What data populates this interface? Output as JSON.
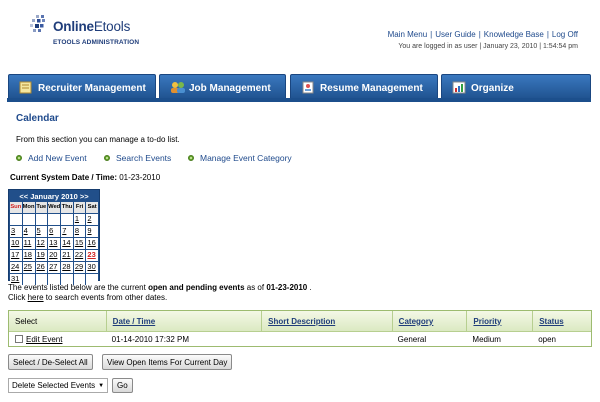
{
  "header": {
    "logo_title_bold": "Online",
    "logo_title_rest": "Etools",
    "logo_subtitle": "ETOOLS ADMINISTRATION",
    "links": [
      "Main Menu",
      "User Guide",
      "Knowledge Base",
      "Log Off"
    ],
    "logged_in_text": "You are logged in as user | January 23, 2010 | 1:54:54 pm"
  },
  "tabs": [
    {
      "label": "Recruiter Management",
      "icon": "notepad-icon"
    },
    {
      "label": "Job Management",
      "icon": "people-icon"
    },
    {
      "label": "Resume Management",
      "icon": "resume-icon"
    },
    {
      "label": "Organize",
      "icon": "chart-icon"
    }
  ],
  "page": {
    "title": "Calendar",
    "intro": "From this section you can manage a to-do list.",
    "actions": [
      "Add New Event",
      "Search Events",
      "Manage Event Category"
    ],
    "current_date_label": "Current System Date / Time:",
    "current_date_value": "01-23-2010"
  },
  "calendar": {
    "header": "<< January 2010 >>",
    "days": [
      "Sun",
      "Mon",
      "Tue",
      "Wed",
      "Thu",
      "Fri",
      "Sat"
    ],
    "weeks": [
      [
        "",
        "",
        "",
        "",
        "",
        "1",
        "2"
      ],
      [
        "3",
        "4",
        "5",
        "6",
        "7",
        "8",
        "9"
      ],
      [
        "10",
        "11",
        "12",
        "13",
        "14",
        "15",
        "16"
      ],
      [
        "17",
        "18",
        "19",
        "20",
        "21",
        "22",
        "23"
      ],
      [
        "24",
        "25",
        "26",
        "27",
        "28",
        "29",
        "30"
      ],
      [
        "31",
        "",
        "",
        "",
        "",
        "",
        ""
      ]
    ],
    "today": "23"
  },
  "listing": {
    "pre": "The events listed below are the current ",
    "bold": "open and pending events",
    "mid": " as of ",
    "date": "01-23-2010",
    "post": " .",
    "line2_pre": "Click ",
    "line2_link": "here",
    "line2_post": " to search events from other dates."
  },
  "table": {
    "headers": [
      "Select",
      "Date / Time",
      "Short Description",
      "Category",
      "Priority",
      "Status"
    ],
    "rows": [
      {
        "select_label": "Edit Event",
        "datetime": "01-14-2010 17:32 PM",
        "description": "",
        "category": "General",
        "priority": "Medium",
        "status": "open"
      }
    ]
  },
  "buttons": {
    "select_all": "Select / De-Select All",
    "view_open": "View Open Items For Current Day",
    "go": "Go"
  },
  "bulk_action": {
    "selected": "Delete Selected Events"
  },
  "colors": {
    "tab_blue": "#1f528f",
    "link_blue": "#1f4a8c",
    "green_bullet": "#63a32c",
    "today_red": "#d02020"
  }
}
